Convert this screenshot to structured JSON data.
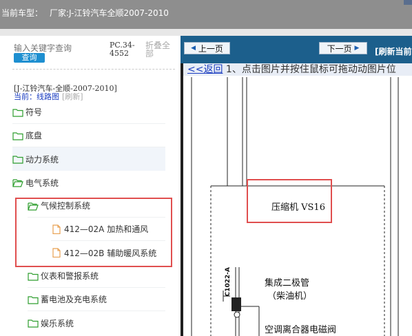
{
  "header": {
    "model_label": "当前车型：",
    "model_value": "厂家:J-江铃汽车全顺2007-2010"
  },
  "sidebar": {
    "search_placeholder": "输入关键字查询",
    "search_button": "查询",
    "pc_code": "PC.34-4552",
    "fold_all": "折叠全部",
    "breadcrumb_vehicle": "[J-江铃汽车-全顺-2007-2010]",
    "breadcrumb_current": "当前：线路图",
    "breadcrumb_refresh": "[刷新]"
  },
  "tree": [
    {
      "label": "符号",
      "icon": "folder-icon"
    },
    {
      "label": "底盘",
      "icon": "folder-icon"
    },
    {
      "label": "动力系统",
      "icon": "folder-icon"
    },
    {
      "label": "电气系统",
      "icon": "folder-open-icon"
    },
    {
      "label": "气候控制系统",
      "icon": "folder-open-icon"
    },
    {
      "label": "412—02A 加热和通风",
      "icon": "document-icon"
    },
    {
      "label": "412—02B 辅助暖风系统",
      "icon": "document-icon"
    },
    {
      "label": "仪表和警报系统",
      "icon": "folder-icon"
    },
    {
      "label": "蓄电池及充电系统",
      "icon": "folder-icon"
    },
    {
      "label": "娱乐系统",
      "icon": "folder-icon"
    }
  ],
  "viewer": {
    "prev_label": "上一页",
    "next_label": "下一页",
    "refresh_current": "[刷新当前",
    "back_link": "<<返回",
    "instruction": "1、点击图片并按住鼠标可拖动动图片位",
    "compressor_label": "压缩机 VS16",
    "diode_label_1": "集成二极管",
    "diode_label_2": "（柴油机）",
    "bottom_label": "空调离合器电磁阀",
    "vertical_label": "C1022-A"
  },
  "colors": {
    "header_bg": "#8e8e8e",
    "toolbar_bg": "#1c5f8c",
    "search_button_bg": "#1e8fd0",
    "highlight_box": "#e04e4e",
    "link_color": "#1a3cc0",
    "folder_color": "#2e9e2e",
    "document_color": "#e8a050"
  }
}
